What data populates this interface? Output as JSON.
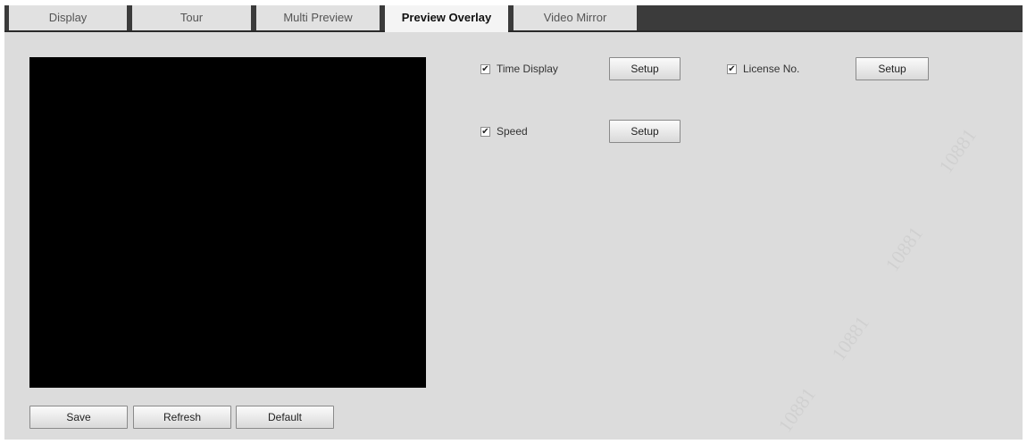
{
  "tabs": [
    {
      "label": "Display"
    },
    {
      "label": "Tour"
    },
    {
      "label": "Multi Preview"
    },
    {
      "label": "Preview Overlay"
    },
    {
      "label": "Video Mirror"
    }
  ],
  "active_tab": "Preview Overlay",
  "overlay_options": [
    {
      "label": "Time Display",
      "checked": true,
      "button": "Setup"
    },
    {
      "label": "License No.",
      "checked": true,
      "button": "Setup"
    },
    {
      "label": "Speed",
      "checked": true,
      "button": "Setup"
    }
  ],
  "footer_buttons": {
    "save": "Save",
    "refresh": "Refresh",
    "default": "Default"
  },
  "checkmark_glyph": "✔",
  "watermark_text": "10881",
  "colors": {
    "tab_bar": "#3b3b3b",
    "panel_background": "#dcdcdc",
    "preview_background": "#000000"
  }
}
